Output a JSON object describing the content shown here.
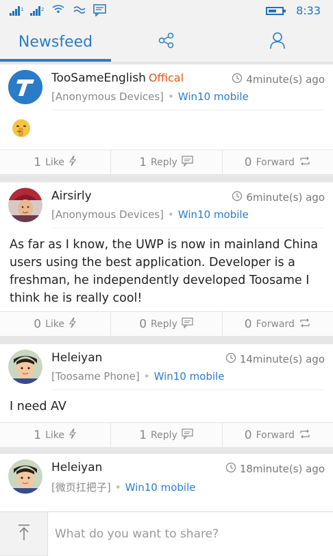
{
  "status_bar": {
    "time": "8:33",
    "battery_level": 0.6
  },
  "tabs": {
    "newsfeed": "Newsfeed"
  },
  "posts": [
    {
      "name": "TooSameEnglish",
      "badge": "Offical",
      "time": "4minute(s) ago",
      "device": "[Anonymous Devices]",
      "platform": "Win10 mobile",
      "body": "",
      "like": "1",
      "like_label": "Like",
      "reply": "1",
      "reply_label": "Reply",
      "forward": "0",
      "forward_label": "Forward"
    },
    {
      "name": "Airsirly",
      "badge": "",
      "time": "6minute(s) ago",
      "device": "[Anonymous Devices]",
      "platform": "Win10 mobile",
      "body": "As far as I know, the UWP is now in mainland China users using the best application. Developer is a freshman, he independently developed Toosame I think he is really cool!",
      "like": "0",
      "like_label": "Like",
      "reply": "0",
      "reply_label": "Reply",
      "forward": "0",
      "forward_label": "Forward"
    },
    {
      "name": "Heleiyan",
      "badge": "",
      "time": "14minute(s) ago",
      "device": "[Toosame Phone]",
      "platform": "Win10 mobile",
      "body": "I need AV",
      "like": "1",
      "like_label": "Like",
      "reply": "1",
      "reply_label": "Reply",
      "forward": "0",
      "forward_label": "Forward"
    },
    {
      "name": "Heleiyan",
      "badge": "",
      "time": "18minute(s) ago",
      "device": "[微页扛把子]",
      "platform": "Win10 mobile"
    }
  ],
  "compose": {
    "placeholder": "What do you want to share?"
  },
  "colors": {
    "accent": "#2a7cc7",
    "official": "#e2581e"
  }
}
